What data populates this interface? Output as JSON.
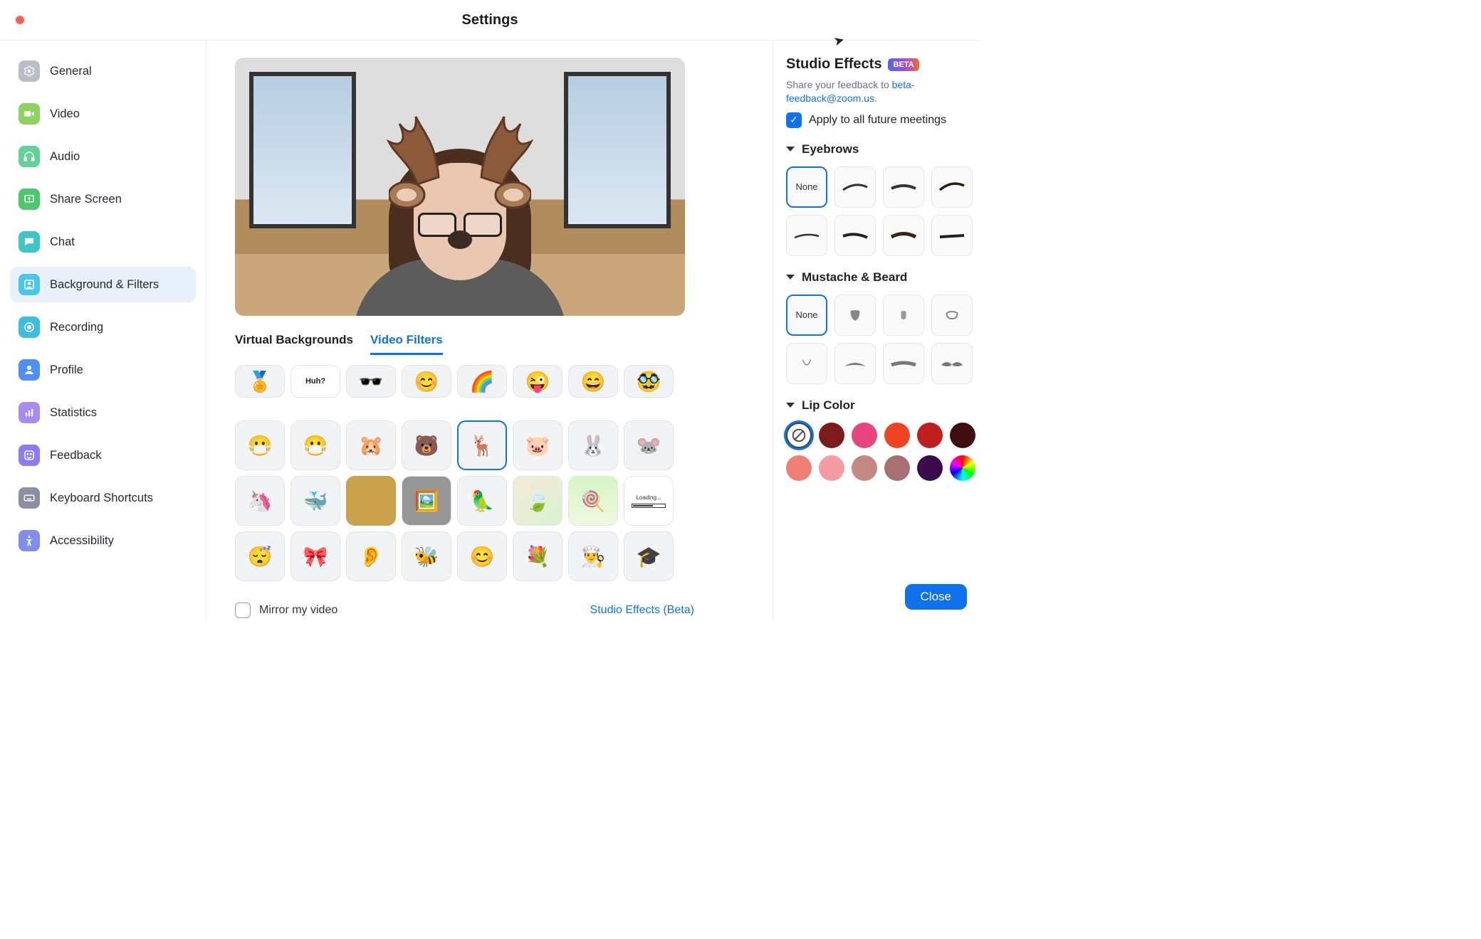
{
  "window_title": "Settings",
  "sidebar": {
    "items": [
      {
        "id": "general",
        "label": "General",
        "icon": "gear",
        "color": "#b9bec6"
      },
      {
        "id": "video",
        "label": "Video",
        "icon": "video",
        "color": "#8ed25f"
      },
      {
        "id": "audio",
        "label": "Audio",
        "icon": "headphones",
        "color": "#62d29a"
      },
      {
        "id": "share",
        "label": "Share Screen",
        "icon": "share-screen",
        "color": "#4ec76d"
      },
      {
        "id": "chat",
        "label": "Chat",
        "icon": "chat",
        "color": "#3ec6c9"
      },
      {
        "id": "bg",
        "label": "Background & Filters",
        "icon": "portrait",
        "color": "#48c7eb",
        "selected": true
      },
      {
        "id": "recording",
        "label": "Recording",
        "icon": "record",
        "color": "#3zbddf"
      },
      {
        "id": "profile",
        "label": "Profile",
        "icon": "user",
        "color": "#4f8ff7"
      },
      {
        "id": "statistics",
        "label": "Statistics",
        "icon": "bars",
        "color": "#a98bf2"
      },
      {
        "id": "feedback",
        "label": "Feedback",
        "icon": "smile",
        "color": "#8b7bf5"
      },
      {
        "id": "shortcuts",
        "label": "Keyboard Shortcuts",
        "icon": "keyboard",
        "color": "#8a8fa3"
      },
      {
        "id": "accessibility",
        "label": "Accessibility",
        "icon": "accessibility",
        "color": "#7e8eed"
      }
    ]
  },
  "sidebar_icon_colors": {
    "general": "#b9bec6",
    "video": "#8ed25f",
    "audio": "#62d29a",
    "share": "#4ec76d",
    "chat": "#3ec6c9",
    "bg": "#48c7eb",
    "recording": "#3dbddf",
    "profile": "#4f8ff7",
    "statistics": "#a98bf2",
    "feedback": "#8b7bf5",
    "shortcuts": "#8a8fa3",
    "accessibility": "#7e8eed"
  },
  "main": {
    "tabs": {
      "virtual": "Virtual Backgrounds",
      "filters": "Video Filters",
      "active": "filters"
    },
    "mirror_label": "Mirror my video",
    "mirror_checked": false,
    "studio_link": "Studio Effects (Beta)",
    "filters_row1": [
      "medal",
      "speech-huh",
      "pixel-sunglasses",
      "cute-face",
      "rainbow-hat",
      "winking-face",
      "happy-face",
      "mustache-face"
    ],
    "filters_row1_labels": {
      "speech-huh": "Huh?"
    },
    "filters_row2": [
      "face-mask",
      "surgical-mask",
      "hamster",
      "bear",
      "deer-antlers",
      "pig",
      "rabbit",
      "mouse"
    ],
    "filters_row2_selected": "deer-antlers",
    "filters_row3": [
      "unicorn",
      "narwhal",
      "picture-frame",
      "museum-room",
      "cockatiel",
      "leaves",
      "lollipops",
      "loading-bar"
    ],
    "filters_row3_labels": {
      "loading-bar": "Loading..."
    },
    "filters_row4": [
      "sleeping-face",
      "red-bow",
      "shrek-ears",
      "bee-antennae",
      "gold-earrings",
      "hydrangea",
      "chef-hat",
      "graduation-cap"
    ]
  },
  "panel": {
    "title": "Studio Effects",
    "badge": "BETA",
    "feedback_text": "Share your feedback to ",
    "feedback_email": "beta-feedback@zoom.us",
    "feedback_suffix": ".",
    "apply_label": "Apply to all future meetings",
    "apply_checked": true,
    "sections": {
      "eyebrows": {
        "title": "Eyebrows",
        "none_label": "None",
        "selected": "none",
        "count": 7
      },
      "beard": {
        "title": "Mustache & Beard",
        "none_label": "None",
        "selected": "none",
        "count": 7
      },
      "lip": {
        "title": "Lip Color",
        "selected": "none",
        "colors": [
          "none",
          "#7d1a1a",
          "#e8447e",
          "#ef4423",
          "#c01f1f",
          "#3e0d0d",
          "#f08075",
          "#f59ca0",
          "#c48980",
          "#a96f72",
          "#3b0a4a",
          "rainbow"
        ]
      }
    },
    "close_label": "Close"
  }
}
